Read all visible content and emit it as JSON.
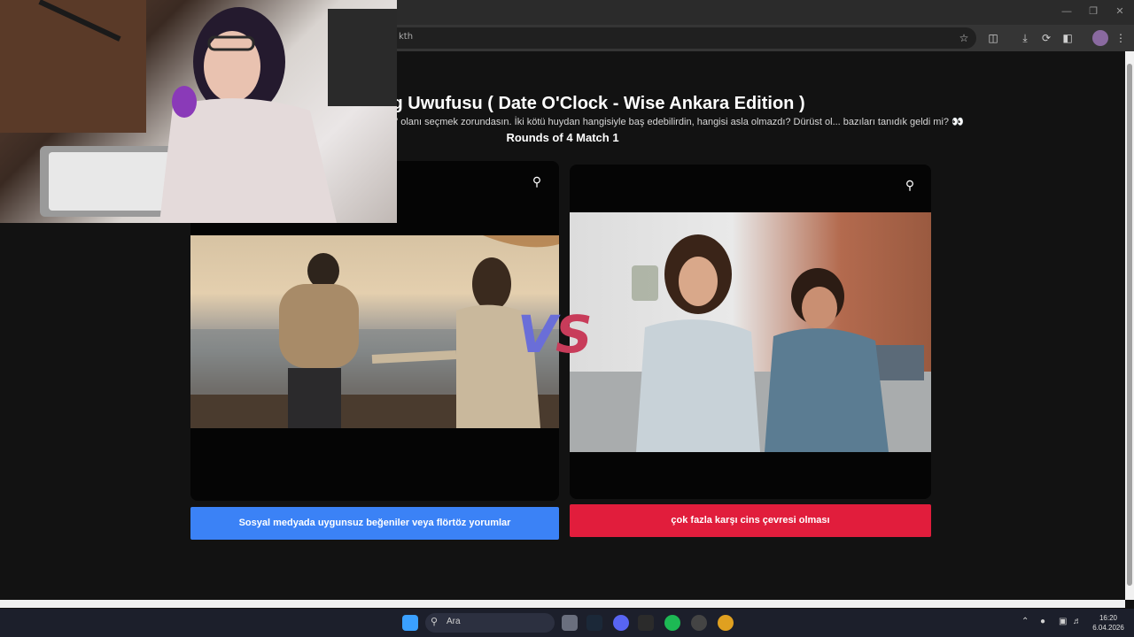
{
  "browser": {
    "url_fragment": "kth",
    "window_controls": [
      "minimize-icon",
      "maximize-icon",
      "close-icon"
    ],
    "toolbar_icons": [
      "star-icon",
      "extensions-icon",
      "download-icon",
      "history-icon",
      "translate-icon",
      "profile-icon",
      "menu-icon"
    ]
  },
  "page": {
    "title": "ag Uwufusu ( Date O'Clock - Wise Ankara Edition )",
    "description": "şer\" olanı seçmek zorundasın. İki kötü huydan hangisiyle baş edebilirdin, hangisi asla olmazdı? Dürüst ol... bazıları tanıdık geldi mi? 👀",
    "round_info": "Rounds of 4 Match 1",
    "vs_v": "V",
    "vs_s": "S"
  },
  "choices": {
    "left": {
      "label": "Sosyal medyada uygunsuz beğeniler veya flörtöz yorumlar",
      "color": "#3b82f6"
    },
    "right": {
      "label": "çok fazla karşı cins çevresi olması",
      "color": "#e11d3c"
    }
  },
  "taskbar": {
    "search_label": "Ara",
    "time": "16:20",
    "date": "6.04.2026"
  }
}
